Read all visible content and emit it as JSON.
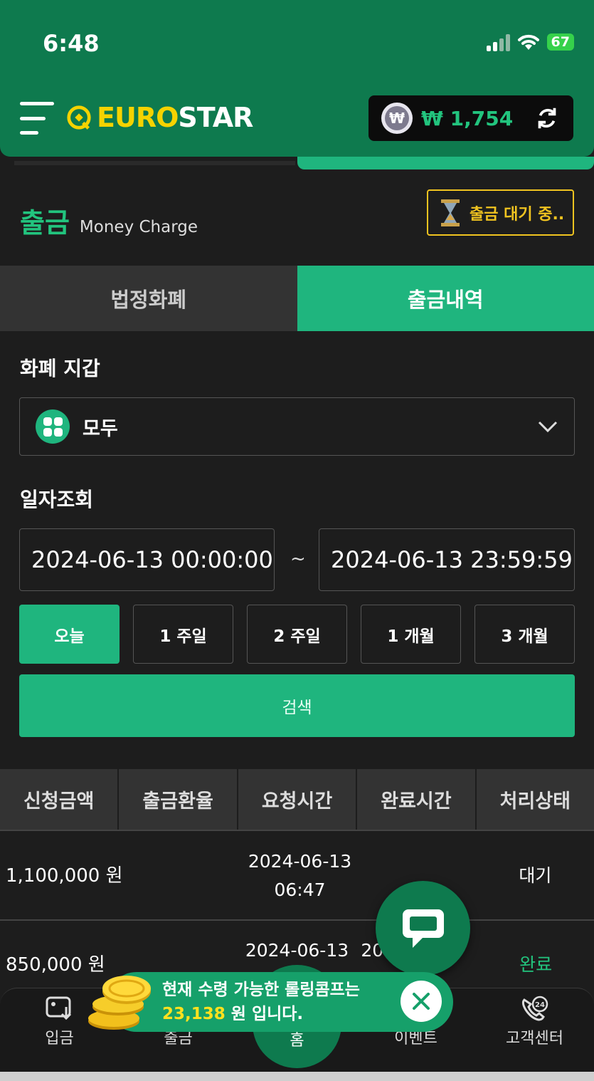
{
  "status_bar": {
    "time": "6:48",
    "battery": "67"
  },
  "header": {
    "logo_part1": "EURO",
    "logo_part2": "STAR",
    "wallet_currency_symbol": "₩",
    "wallet_amount": "₩ 1,754"
  },
  "page": {
    "title": "출금",
    "subtitle": "Money Charge",
    "pending_label": "출금 대기 중.."
  },
  "tabs": [
    {
      "label": "법정화폐",
      "active": false
    },
    {
      "label": "출금내역",
      "active": true
    }
  ],
  "wallet_filter": {
    "label": "화폐 지갑",
    "selected": "모두"
  },
  "date_filter": {
    "label": "일자조회",
    "start": "2024-06-13 00:00:00",
    "separator": "~",
    "end": "2024-06-13 23:59:59",
    "ranges": [
      {
        "label": "오늘",
        "active": true
      },
      {
        "label": "1 주일",
        "active": false
      },
      {
        "label": "2 주일",
        "active": false
      },
      {
        "label": "1 개월",
        "active": false
      },
      {
        "label": "3 개월",
        "active": false
      }
    ],
    "search_label": "검색"
  },
  "table": {
    "columns": [
      "신청금액",
      "출금환율",
      "요청시간",
      "완료시간",
      "처리상태"
    ],
    "rows": [
      {
        "amount": "1,100,000 원",
        "rate": "",
        "request_date": "2024-06-13",
        "request_time": "06:47",
        "complete_date": "",
        "complete_time": "",
        "status": "대기"
      },
      {
        "amount": "850,000 원",
        "rate": "",
        "request_date": "2024-06-13",
        "request_time": "",
        "complete_date": "20",
        "complete_time": "",
        "status": "완료"
      }
    ]
  },
  "toast": {
    "line1": "현재 수령 가능한 롤링콤프는",
    "amount": "23,138",
    "line2_suffix": " 원 입니다."
  },
  "bottom_nav": [
    {
      "label": "입금",
      "icon": "deposit-icon"
    },
    {
      "label": "출금",
      "icon": "withdraw-icon"
    },
    {
      "label": "홈",
      "icon": "home-icon"
    },
    {
      "label": "이벤트",
      "icon": "event-icon"
    },
    {
      "label": "고객센터",
      "icon": "support-24-icon"
    }
  ],
  "colors": {
    "brand_green": "#0e7a4e",
    "accent_green": "#1fb57e",
    "gold": "#f0c320",
    "logo_yellow": "#f5d300"
  }
}
